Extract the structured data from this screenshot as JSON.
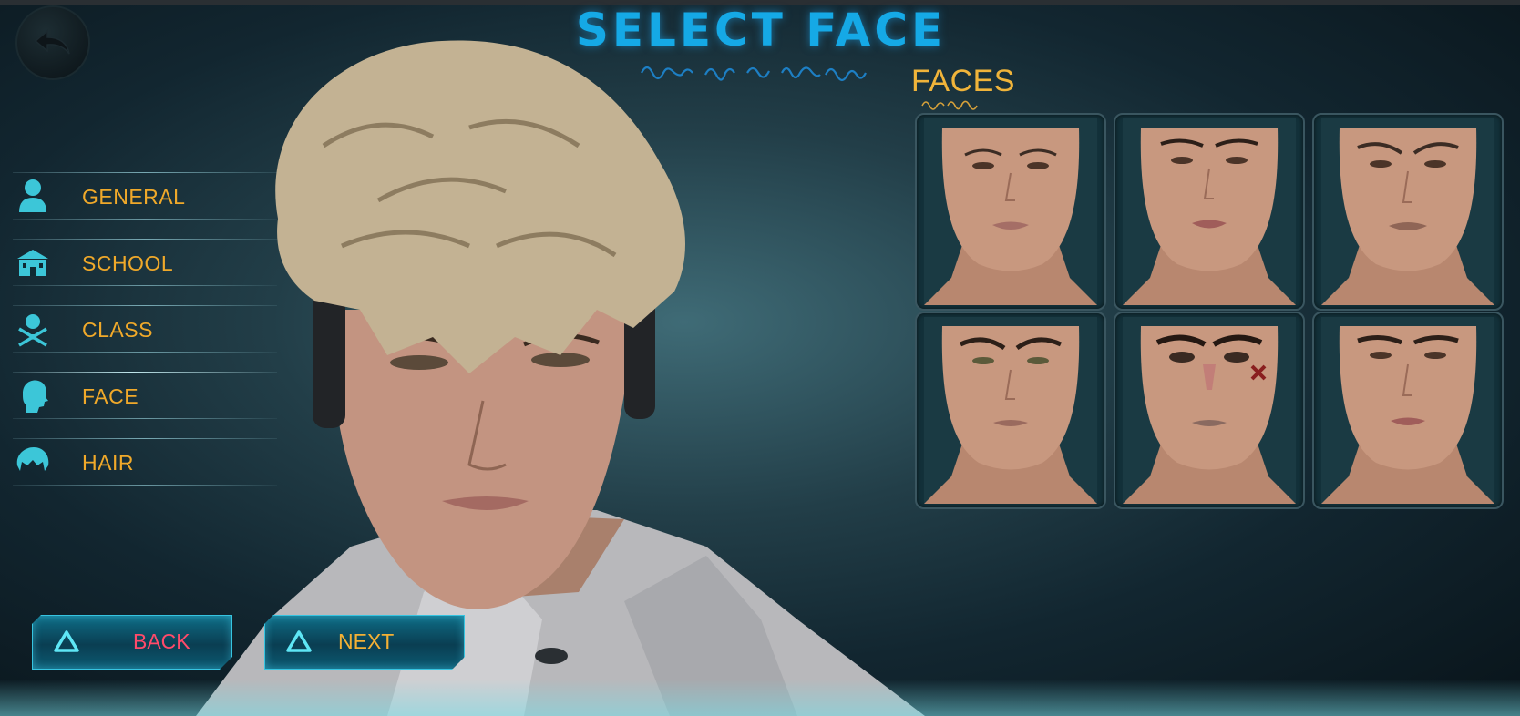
{
  "screen": {
    "title": "SELECT FACE"
  },
  "menu": {
    "items": [
      {
        "label": "GENERAL",
        "icon": "person-icon"
      },
      {
        "label": "SCHOOL",
        "icon": "school-building-icon"
      },
      {
        "label": "CLASS",
        "icon": "crossed-swords-class-icon"
      },
      {
        "label": "FACE",
        "icon": "head-profile-icon"
      },
      {
        "label": "HAIR",
        "icon": "hair-icon"
      }
    ],
    "active": "FACE"
  },
  "faces": {
    "title": "FACES",
    "options": [
      {
        "variant": "face-1"
      },
      {
        "variant": "face-2"
      },
      {
        "variant": "face-3"
      },
      {
        "variant": "face-4"
      },
      {
        "variant": "face-5-scarred"
      },
      {
        "variant": "face-6"
      }
    ]
  },
  "buttons": {
    "back_label": "BACK",
    "next_label": "NEXT"
  },
  "colors": {
    "accent_gold": "#f0a92a",
    "title_blue": "#15a9e6",
    "back_red": "#ff4a6a",
    "icon_cyan": "#3cc6d8"
  }
}
